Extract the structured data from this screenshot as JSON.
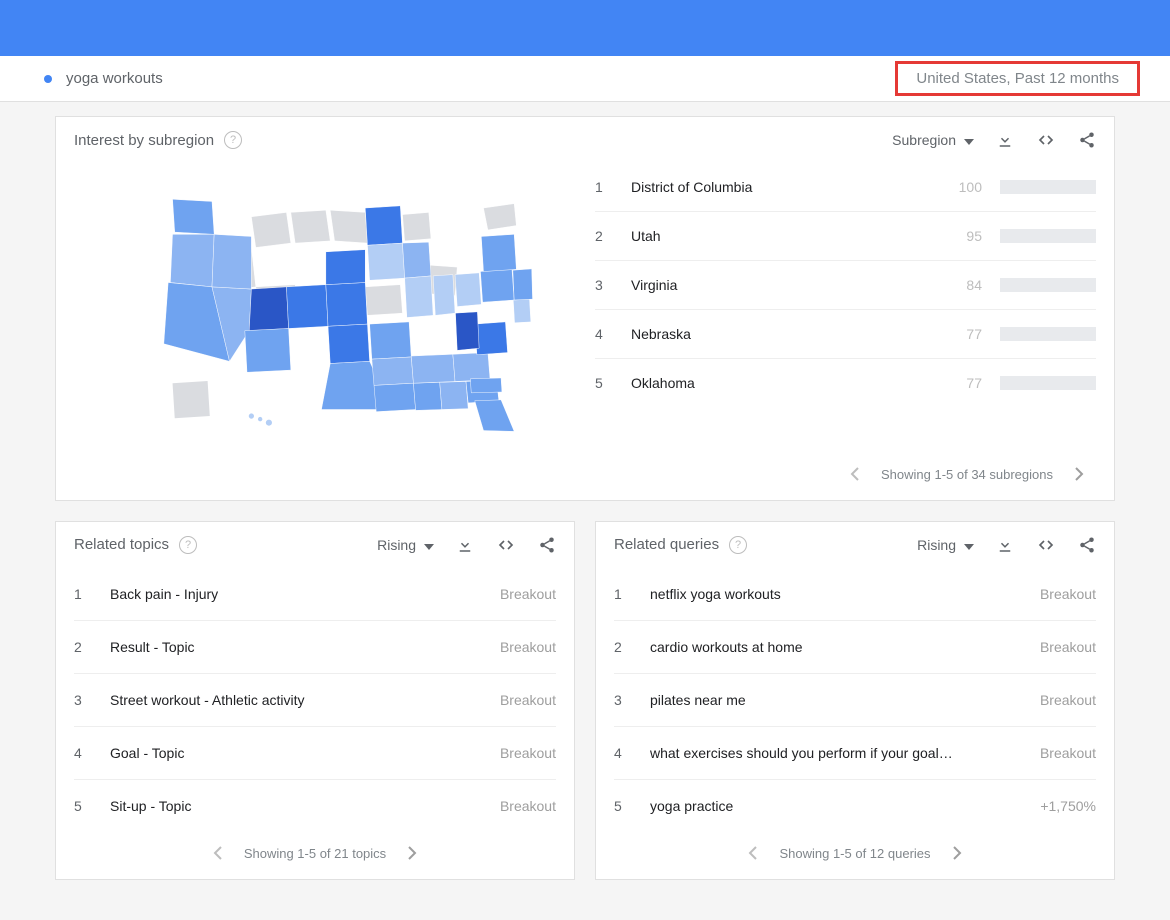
{
  "search": {
    "term": "yoga workouts",
    "filters": "United States, Past 12 months"
  },
  "region_card": {
    "title": "Interest by subregion",
    "dropdown": "Subregion",
    "rows": [
      {
        "rank": "1",
        "name": "District of Columbia",
        "value": "100",
        "pct": 100
      },
      {
        "rank": "2",
        "name": "Utah",
        "value": "95",
        "pct": 95
      },
      {
        "rank": "3",
        "name": "Virginia",
        "value": "84",
        "pct": 84
      },
      {
        "rank": "4",
        "name": "Nebraska",
        "value": "77",
        "pct": 77
      },
      {
        "rank": "5",
        "name": "Oklahoma",
        "value": "77",
        "pct": 77
      }
    ],
    "pagination": "Showing 1-5 of 34 subregions"
  },
  "topics_card": {
    "title": "Related topics",
    "dropdown": "Rising",
    "rows": [
      {
        "rank": "1",
        "label": "Back pain - Injury",
        "metric": "Breakout"
      },
      {
        "rank": "2",
        "label": "Result - Topic",
        "metric": "Breakout"
      },
      {
        "rank": "3",
        "label": "Street workout - Athletic activity",
        "metric": "Breakout"
      },
      {
        "rank": "4",
        "label": "Goal - Topic",
        "metric": "Breakout"
      },
      {
        "rank": "5",
        "label": "Sit-up - Topic",
        "metric": "Breakout"
      }
    ],
    "pagination": "Showing 1-5 of 21 topics"
  },
  "queries_card": {
    "title": "Related queries",
    "dropdown": "Rising",
    "rows": [
      {
        "rank": "1",
        "label": "netflix yoga workouts",
        "metric": "Breakout"
      },
      {
        "rank": "2",
        "label": "cardio workouts at home",
        "metric": "Breakout"
      },
      {
        "rank": "3",
        "label": "pilates near me",
        "metric": "Breakout"
      },
      {
        "rank": "4",
        "label": "what exercises should you perform if your goal…",
        "metric": "Breakout"
      },
      {
        "rank": "5",
        "label": "yoga practice",
        "metric": "+1,750%"
      }
    ],
    "pagination": "Showing 1-5 of 12 queries"
  }
}
